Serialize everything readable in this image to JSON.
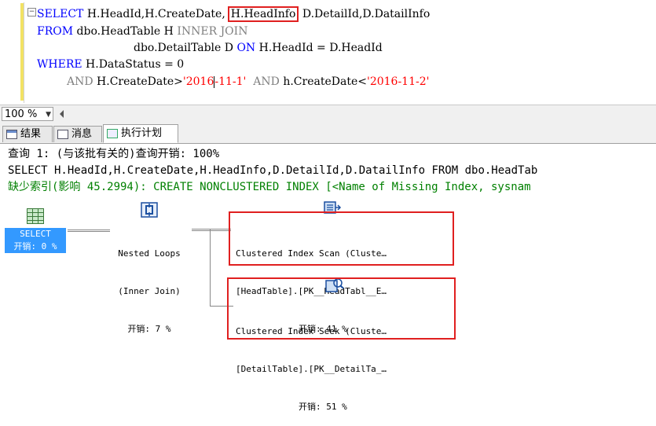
{
  "editor": {
    "lines": [
      {
        "kw1": "SELECT",
        "text1": " H.HeadId,H.CreateDate,",
        "highlight": "H.HeadInfo",
        "text2": " D.DetailId,D.DatailInfo"
      },
      {
        "kw1": "FROM",
        "text1": " dbo.HeadTable H ",
        "kw2": "INNER JOIN"
      },
      {
        "text1": "dbo.DetailTable D ",
        "kw1": "ON",
        "text2": " H.HeadId = D.HeadId"
      },
      {
        "kw1": "WHERE",
        "text1": " H.DataStatus = 0"
      },
      {
        "kw1": "AND",
        "text1": " H.CreateDate>",
        "str1a": "'2016",
        "str1b": "-11-1'",
        "kw2": "AND",
        "text2": " h.CreateDate<",
        "str2": "'2016-11-2'"
      }
    ]
  },
  "zoom": {
    "value": "100 %"
  },
  "tabs": [
    {
      "label": "结果",
      "icon": "results-grid-icon"
    },
    {
      "label": "消息",
      "icon": "messages-icon"
    },
    {
      "label": "执行计划",
      "icon": "execution-plan-icon"
    }
  ],
  "plan": {
    "query_header": "查询 1: (与该批有关的)查询开销: 100%",
    "query_sql": "SELECT H.HeadId,H.CreateDate,H.HeadInfo,D.DetailId,D.DatailInfo FROM dbo.HeadTab",
    "missing_index": "缺少索引(影响 45.2994): CREATE NONCLUSTERED INDEX [<Name of Missing Index, sysnam",
    "nodes": {
      "select": {
        "title": "SELECT",
        "cost": "开销: 0 %"
      },
      "nested": {
        "title": "Nested Loops",
        "sub": "(Inner Join)",
        "cost": "开销: 7 %"
      },
      "scan": {
        "title": "Clustered Index Scan (Cluste…",
        "sub": "[HeadTable].[PK__HeadTabl__E…",
        "cost": "开销: 41 %"
      },
      "seek": {
        "title": "Clustered Index Seek (Cluste…",
        "sub": "[DetailTable].[PK__DetailTa_…",
        "cost": "开销: 51 %"
      }
    }
  },
  "colors": {
    "keyword": "#0000ff",
    "string": "#ff0000",
    "highlight_border": "#e02020",
    "missing_index": "#008000",
    "select_bg": "#3399ff"
  }
}
